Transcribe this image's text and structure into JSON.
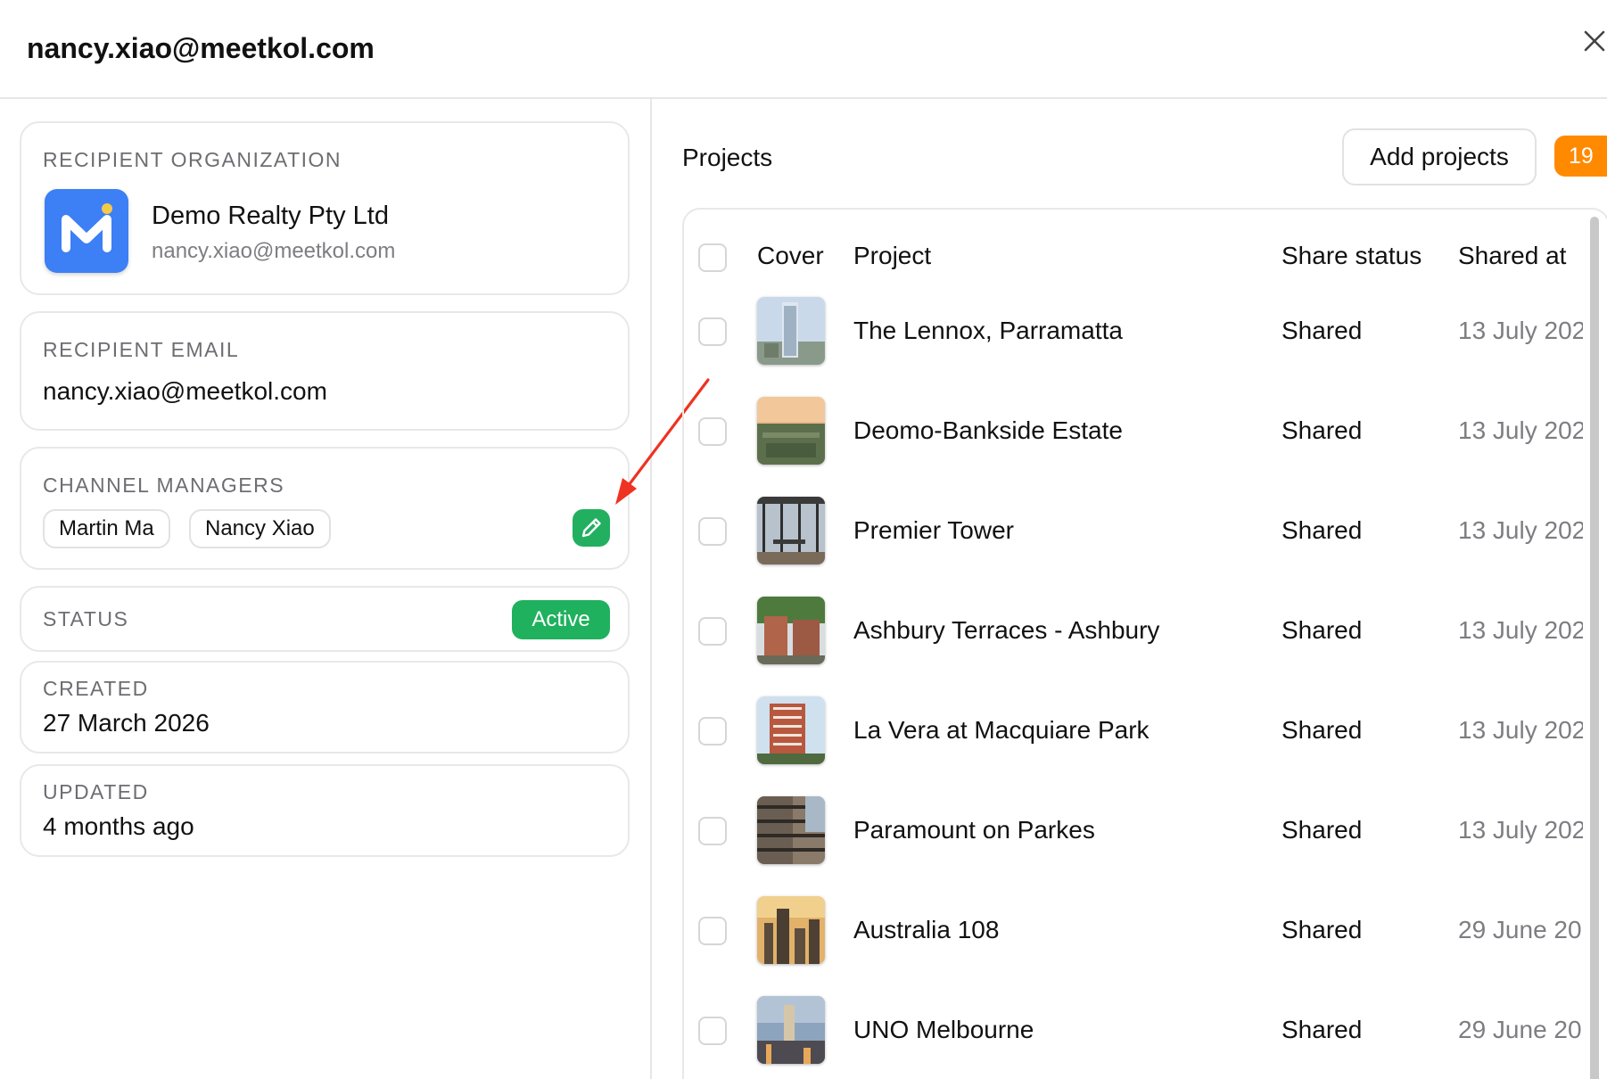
{
  "header": {
    "title": "nancy.xiao@meetkol.com",
    "close_icon": "close-icon"
  },
  "recipient_org": {
    "label": "RECIPIENT ORGANIZATION",
    "name": "Demo Realty Pty Ltd",
    "email": "nancy.xiao@meetkol.com",
    "logo_color": "#3d7ff5"
  },
  "recipient_email": {
    "label": "RECIPIENT EMAIL",
    "value": "nancy.xiao@meetkol.com"
  },
  "channel_managers": {
    "label": "CHANNEL MANAGERS",
    "managers": [
      "Martin Ma",
      "Nancy Xiao"
    ],
    "edit_icon": "pencil-icon",
    "edit_color": "#22b060"
  },
  "status": {
    "label": "STATUS",
    "value": "Active",
    "color": "#1fb15e"
  },
  "created": {
    "label": "CREATED",
    "value": "27 March 2026"
  },
  "updated": {
    "label": "UPDATED",
    "value": "4 months ago"
  },
  "projects": {
    "title": "Projects",
    "add_label": "Add projects",
    "count": "19",
    "count_color": "#ff8a00",
    "columns": [
      "Cover",
      "Project",
      "Share status",
      "Shared at"
    ],
    "rows": [
      {
        "project": "The Lennox, Parramatta",
        "status": "Shared",
        "date": "13 July 202"
      },
      {
        "project": "Deomo-Bankside Estate",
        "status": "Shared",
        "date": "13 July 202"
      },
      {
        "project": "Premier Tower",
        "status": "Shared",
        "date": "13 July 202"
      },
      {
        "project": "Ashbury Terraces - Ashbury",
        "status": "Shared",
        "date": "13 July 202"
      },
      {
        "project": "La Vera at Macquiare Park",
        "status": "Shared",
        "date": "13 July 202"
      },
      {
        "project": "Paramount on Parkes",
        "status": "Shared",
        "date": "13 July 202"
      },
      {
        "project": "Australia 108",
        "status": "Shared",
        "date": "29 June 20"
      },
      {
        "project": "UNO Melbourne",
        "status": "Shared",
        "date": "29 June 20"
      }
    ]
  },
  "annotation": {
    "arrow_color": "#ee3322"
  }
}
